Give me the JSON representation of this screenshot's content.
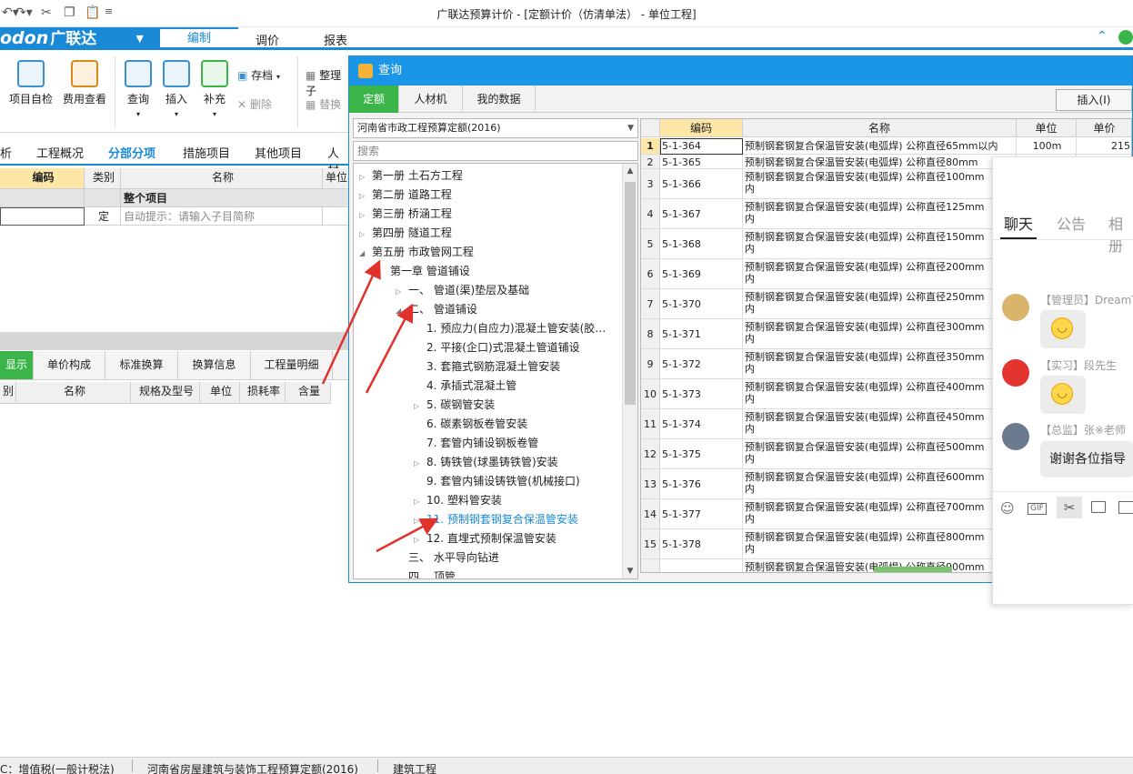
{
  "window": {
    "title": "广联达预算计价 - [定额计价（仿清单法） - 单位工程]"
  },
  "menubar": {
    "logo_text": "odon",
    "logo_cn": "广联达",
    "tabs": [
      "编制",
      "调价",
      "报表"
    ]
  },
  "ribbon": {
    "project_check": "项目自检",
    "fee_view": "费用查看",
    "query": "查询",
    "insert": "插入",
    "supplement": "补充",
    "save": "存档",
    "delete": "删除",
    "organize": "整理子",
    "replace": "替换"
  },
  "main_tabs": {
    "t0": "析",
    "t1": "工程概况",
    "t2": "分部分项",
    "t3": "措施项目",
    "t4": "其他项目",
    "t5": "人材"
  },
  "grid": {
    "col_code": "编码",
    "col_type": "类别",
    "col_name": "名称",
    "col_unit": "单位",
    "row1_name": "整个项目",
    "row2_type": "定",
    "row2_name": "自动提示：请输入子目简称"
  },
  "lower_tabs": {
    "t0": "显示",
    "t1": "单价构成",
    "t2": "标准换算",
    "t3": "换算信息",
    "t4": "工程量明细"
  },
  "lower_cols": {
    "c0": "别",
    "c1": "名称",
    "c2": "规格及型号",
    "c3": "单位",
    "c4": "损耗率",
    "c5": "含量"
  },
  "status": {
    "s0": "C：增值税(一般计税法)",
    "s1": "河南省房屋建筑与装饰工程预算定额(2016)",
    "s2": "建筑工程"
  },
  "dialog": {
    "title": "查询",
    "tabs": [
      "定额",
      "人材机",
      "我的数据"
    ],
    "insert_button": "插入(I)",
    "library": "河南省市政工程预算定额(2016)",
    "search_placeholder": "搜索"
  },
  "tree": [
    {
      "label": "第一册  土石方工程"
    },
    {
      "label": "第二册  道路工程"
    },
    {
      "label": "第三册  桥涵工程"
    },
    {
      "label": "第四册  隧道工程"
    },
    {
      "label": "第五册  市政管网工程"
    },
    {
      "label": "第一章  管道铺设"
    },
    {
      "label": "一、  管道(渠)垫层及基础"
    },
    {
      "label": "二、  管道铺设"
    },
    {
      "label": "1.  预应力(自应力)混凝土管安装(胶…"
    },
    {
      "label": "2.  平接(企口)式混凝土管道铺设"
    },
    {
      "label": "3.  套箍式钢筋混凝土管安装"
    },
    {
      "label": "4.  承插式混凝土管"
    },
    {
      "label": "5.  碳钢管安装"
    },
    {
      "label": "6.  碳素钢板卷管安装"
    },
    {
      "label": "7.  套管内铺设钢板卷管"
    },
    {
      "label": "8.  铸铁管(球墨铸铁管)安装"
    },
    {
      "label": "9.  套管内铺设铸铁管(机械接口)"
    },
    {
      "label": "10.  塑料管安装"
    },
    {
      "label": "11.  预制钢套钢复合保温管安装"
    },
    {
      "label": "12.  直埋式预制保温管安装"
    },
    {
      "label": "三、  水平导向钻进"
    },
    {
      "label": "四、  顶管"
    }
  ],
  "qtable": {
    "headers": {
      "code": "编码",
      "name": "名称",
      "unit": "单位",
      "price": "单价"
    },
    "first_unit": "100m",
    "first_price": "215",
    "cont": "内",
    "rows": [
      {
        "n": "1",
        "code": "5-1-364",
        "name": "预制钢套钢复合保温管安装(电弧焊)  公称直径65mm以内"
      },
      {
        "n": "2",
        "code": "5-1-365",
        "name": "预制钢套钢复合保温管安装(电弧焊)  公称直径80mm"
      },
      {
        "n": "3",
        "code": "5-1-366",
        "name": "预制钢套钢复合保温管安装(电弧焊)  公称直径100mm"
      },
      {
        "n": "4",
        "code": "5-1-367",
        "name": "预制钢套钢复合保温管安装(电弧焊)  公称直径125mm"
      },
      {
        "n": "5",
        "code": "5-1-368",
        "name": "预制钢套钢复合保温管安装(电弧焊)  公称直径150mm"
      },
      {
        "n": "6",
        "code": "5-1-369",
        "name": "预制钢套钢复合保温管安装(电弧焊)  公称直径200mm"
      },
      {
        "n": "7",
        "code": "5-1-370",
        "name": "预制钢套钢复合保温管安装(电弧焊)  公称直径250mm"
      },
      {
        "n": "8",
        "code": "5-1-371",
        "name": "预制钢套钢复合保温管安装(电弧焊)  公称直径300mm"
      },
      {
        "n": "9",
        "code": "5-1-372",
        "name": "预制钢套钢复合保温管安装(电弧焊)  公称直径350mm"
      },
      {
        "n": "10",
        "code": "5-1-373",
        "name": "预制钢套钢复合保温管安装(电弧焊)  公称直径400mm"
      },
      {
        "n": "11",
        "code": "5-1-374",
        "name": "预制钢套钢复合保温管安装(电弧焊)  公称直径450mm"
      },
      {
        "n": "12",
        "code": "5-1-375",
        "name": "预制钢套钢复合保温管安装(电弧焊)  公称直径500mm"
      },
      {
        "n": "13",
        "code": "5-1-376",
        "name": "预制钢套钢复合保温管安装(电弧焊)  公称直径600mm"
      },
      {
        "n": "14",
        "code": "5-1-377",
        "name": "预制钢套钢复合保温管安装(电弧焊)  公称直径700mm"
      },
      {
        "n": "15",
        "code": "5-1-378",
        "name": "预制钢套钢复合保温管安装(电弧焊)  公称直径800mm"
      },
      {
        "n": "",
        "code": "",
        "name": "预制钢套钢复合保温管安装(电弧焊)  公称直径900mm"
      }
    ]
  },
  "chat": {
    "tabs": [
      "聊天",
      "公告",
      "相册"
    ],
    "m1_name": "【管理员】DreamTe",
    "m2_name": "【实习】段先生",
    "m3_name": "【总监】张※老师",
    "m3_text": "谢谢各位指导",
    "toolbar": [
      "emoji-icon",
      "gif-icon",
      "scissors-icon",
      "folder-icon",
      "image-icon"
    ]
  },
  "colors": {
    "brand": "#1b8ad6",
    "dialog_title": "#1b96e6",
    "active_tab": "#3bb54a",
    "annotation": "#e0322b"
  }
}
